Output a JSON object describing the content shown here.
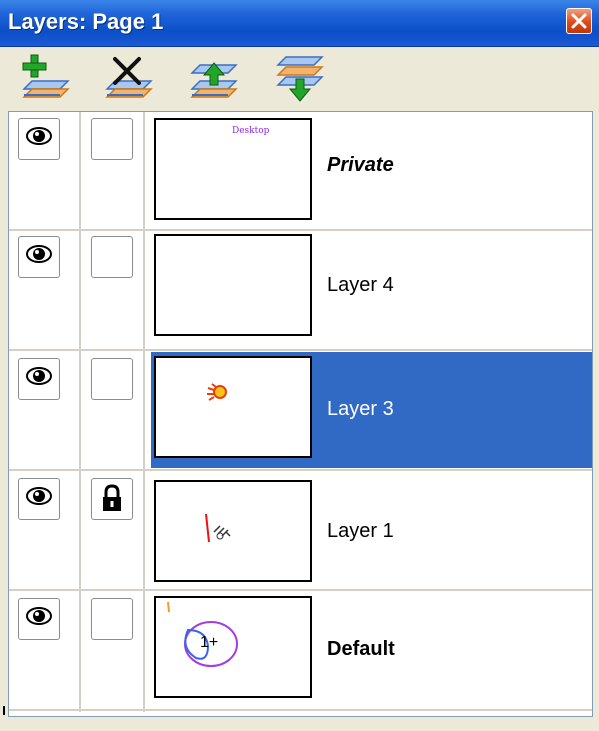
{
  "window": {
    "title": "Layers: Page 1",
    "close_icon": "close-icon",
    "colors": {
      "titlebar": "#0b4fc7",
      "selection": "#316ac5",
      "close": "#e04a1a"
    }
  },
  "toolbar": {
    "buttons": [
      {
        "icon": "new-layer-icon"
      },
      {
        "icon": "delete-layer-icon"
      },
      {
        "icon": "move-layer-up-icon"
      },
      {
        "icon": "move-layer-down-icon"
      }
    ]
  },
  "layers": [
    {
      "name": "Private",
      "visible": true,
      "locked": false,
      "selected": false,
      "style": "bold-italic",
      "thumbnail": "Desktop"
    },
    {
      "name": "Layer 4",
      "visible": true,
      "locked": false,
      "selected": false,
      "style": "normal",
      "thumbnail": ""
    },
    {
      "name": "Layer 3",
      "visible": true,
      "locked": false,
      "selected": true,
      "style": "normal",
      "thumbnail": ""
    },
    {
      "name": "Layer 1",
      "visible": true,
      "locked": true,
      "selected": false,
      "style": "normal",
      "thumbnail": ""
    },
    {
      "name": "Default",
      "visible": true,
      "locked": false,
      "selected": false,
      "style": "bold",
      "thumbnail": "1+"
    }
  ]
}
